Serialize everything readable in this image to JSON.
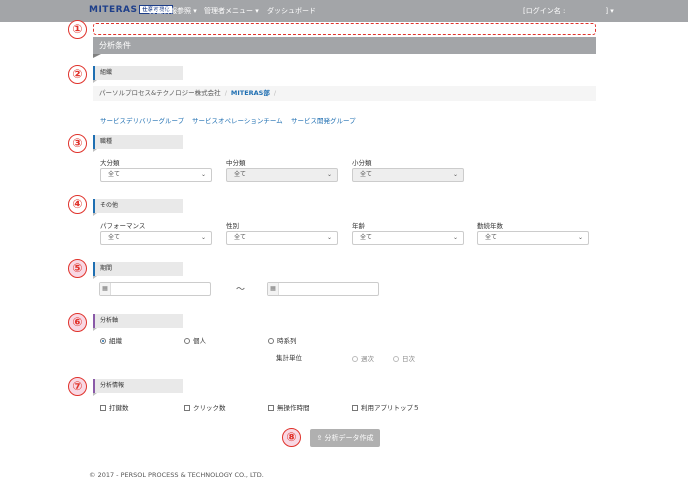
{
  "nav": {
    "logo": "MITERAS",
    "logo_tag": "仕事可視化",
    "items": [
      "労働情報参照 ▾",
      "管理者メニュー ▾",
      "ダッシュボード"
    ],
    "login": "[ログイン名 :",
    "login_suffix": "] ▾"
  },
  "annotations": [
    "①",
    "②",
    "③",
    "④",
    "⑤",
    "⑥",
    "⑦",
    "⑧"
  ],
  "main": {
    "title": "分析条件",
    "org": {
      "heading": "組織",
      "breadcrumb": [
        "パーソルプロセス&テクノロジー株式会社",
        "MITERAS部"
      ],
      "children": [
        "サービスデリバリーグループ",
        "サービスオペレーションチーム",
        "サービス開発グループ"
      ]
    },
    "job": {
      "heading": "職種",
      "fields": [
        {
          "label": "大分類",
          "value": "全て",
          "disabled": false
        },
        {
          "label": "中分類",
          "value": "全て",
          "disabled": true
        },
        {
          "label": "小分類",
          "value": "全て",
          "disabled": true
        }
      ]
    },
    "other": {
      "heading": "その他",
      "fields": [
        {
          "label": "パフォーマンス",
          "value": "全て"
        },
        {
          "label": "性別",
          "value": "全て"
        },
        {
          "label": "年齢",
          "value": "全て"
        },
        {
          "label": "勤続年数",
          "value": "全て"
        }
      ]
    },
    "period": {
      "heading": "期間",
      "separator": "〜"
    },
    "axis": {
      "heading": "分析軸",
      "options": [
        "組織",
        "個人",
        "時系列"
      ],
      "selected": "組織",
      "unit_label": "集計単位",
      "unit_options": [
        "週次",
        "日次"
      ]
    },
    "info": {
      "heading": "分析情報",
      "options": [
        "打鍵数",
        "クリック数",
        "無操作時間",
        "利用アプリトップ５"
      ]
    },
    "submit": "分析データ作成"
  },
  "footer": "© 2017 - PERSOL PROCESS & TECHNOLOGY CO., LTD."
}
